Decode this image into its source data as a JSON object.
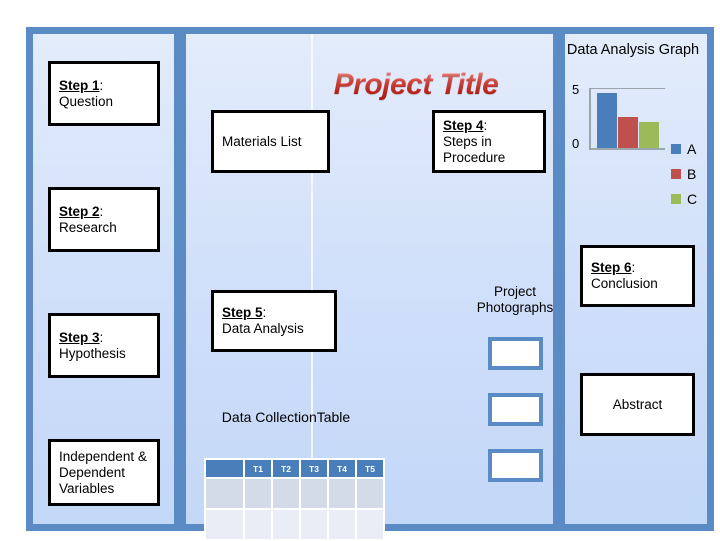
{
  "board": {
    "title": "Project Title",
    "accent_blue": "#5b8bc4",
    "panel_bg": "#cfdffa",
    "title_color": "#cf2a20"
  },
  "left_panel": {
    "boxes": [
      {
        "step": "Step 1",
        "sep": ":",
        "text": "Question"
      },
      {
        "step": "Step 2",
        "sep": ":",
        "text": "Research"
      },
      {
        "step": "Step 3",
        "sep": ":",
        "text": "Hypothesis"
      }
    ],
    "variables_box": "Independent & Dependent Variables"
  },
  "center_panel": {
    "materials_box": "Materials List",
    "step4": {
      "step": "Step 4",
      "sep": ":",
      "text": "Steps in Procedure"
    },
    "step5": {
      "step": "Step 5",
      "sep": ":",
      "text": "Data Analysis"
    },
    "photos_label": "Project Photographs",
    "photo_count": 3,
    "table_label": "Data CollectionTable",
    "table": {
      "headers": [
        "",
        "T1",
        "T2",
        "T3",
        "T4",
        "T5"
      ],
      "rows": [
        [
          "",
          "",
          "",
          "",
          "",
          ""
        ],
        [
          "",
          "",
          "",
          "",
          "",
          ""
        ]
      ]
    }
  },
  "right_panel": {
    "step6": {
      "step": "Step 6",
      "sep": ":",
      "text": "Conclusion"
    },
    "abstract_box": "Abstract"
  },
  "chart_data": {
    "type": "bar",
    "title": "Data Analysis Graph",
    "categories": [
      "A",
      "B",
      "C"
    ],
    "values": [
      4.6,
      2.6,
      2.2
    ],
    "series": [
      {
        "name": "A",
        "value": 4.6,
        "color": "#4a7ebb"
      },
      {
        "name": "B",
        "value": 2.6,
        "color": "#c0504d"
      },
      {
        "name": "C",
        "value": 2.2,
        "color": "#9bbb59"
      }
    ],
    "ylim": [
      0,
      5
    ],
    "ytick_labels": [
      "0",
      "5"
    ],
    "xlabel": "",
    "ylabel": "",
    "grid": true,
    "legend": [
      "A",
      "B",
      "C"
    ],
    "legend_position": "right"
  }
}
